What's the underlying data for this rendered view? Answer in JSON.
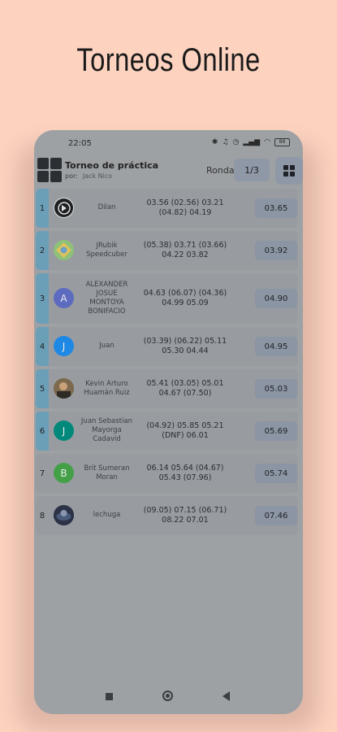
{
  "headline": "Torneos Online",
  "status": {
    "time": "22:05",
    "battery": "88"
  },
  "appbar": {
    "title": "Torneo de práctica",
    "by_label": "por:",
    "author": "Jack Nico",
    "round_label": "Ronda",
    "round_value": "1/3"
  },
  "colors": {
    "accent": "#6b9fb8",
    "background": "#fdd3c0"
  },
  "results": [
    {
      "rank": "1",
      "name": "Dilan",
      "times": "03.56 (02.56) 03.21 (04.82) 04.19",
      "average": "03.65",
      "avatar": "dark-logo",
      "accent": true
    },
    {
      "rank": "2",
      "name": "JRubik Speedcuber",
      "times": "(05.38) 03.71 (03.66) 04.22 03.82",
      "average": "03.92",
      "avatar": "pattern",
      "accent": true
    },
    {
      "rank": "3",
      "name": "ALEXANDER JOSUE MONTOYA BONIFACIO",
      "times": "04.63 (06.07) (04.36) 04.99 05.09",
      "average": "04.90",
      "avatar": "A",
      "accent": true
    },
    {
      "rank": "4",
      "name": "Juan",
      "times": "(03.39) (06.22) 05.11 05.30 04.44",
      "average": "04.95",
      "avatar": "J",
      "accent": true
    },
    {
      "rank": "5",
      "name": "Kevin Arturo Huamán Ruiz",
      "times": "05.41 (03.05) 05.01 04.67 (07.50)",
      "average": "05.03",
      "avatar": "photo",
      "accent": true
    },
    {
      "rank": "6",
      "name": "Juan Sebastian Mayorga Cadavid",
      "times": "(04.92) 05.85 05.21 (DNF) 06.01",
      "average": "05.69",
      "avatar": "J",
      "accent": true
    },
    {
      "rank": "7",
      "name": "Brit Sumeran Moran",
      "times": "06.14 05.64 (04.67) 05.43 (07.96)",
      "average": "05.74",
      "avatar": "B",
      "accent": false
    },
    {
      "rank": "8",
      "name": "lechuga",
      "times": "(09.05) 07.15 (06.71) 08.22 07.01",
      "average": "07.46",
      "avatar": "photo",
      "accent": false
    }
  ]
}
